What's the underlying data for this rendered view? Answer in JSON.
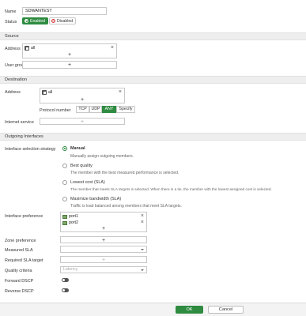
{
  "form": {
    "name_label": "Name",
    "name_value": "SDWANTEST",
    "status_label": "Status",
    "status_enabled": "Enabled",
    "status_disabled": "Disabled",
    "status_selected": "Enabled"
  },
  "source": {
    "header": "Source",
    "address_label": "Address",
    "address_items": [
      "all"
    ],
    "user_group_label": "User group"
  },
  "destination": {
    "header": "Destination",
    "address_label": "Address",
    "address_items": [
      "all"
    ],
    "protocol_label": "Protocol number",
    "protocol_options": [
      "TCP",
      "UDP",
      "ANY",
      "Specify"
    ],
    "protocol_selected": "ANY",
    "internet_service_label": "Internet service"
  },
  "outgoing": {
    "header": "Outgoing Interfaces",
    "strategy_label": "Interface selection strategy",
    "strategies": [
      {
        "title": "Manual",
        "desc": "Manually assign outgoing members."
      },
      {
        "title": "Best quality",
        "desc": "The member with the best measured performance is selected."
      },
      {
        "title": "Lowest cost (SLA)",
        "desc": "The member that meets SLA targets is selected. When there is a tie, the member with the lowest assigned cost is selected."
      },
      {
        "title": "Maximize bandwidth (SLA)",
        "desc": "Traffic is load balanced among members that meet SLA targets."
      }
    ],
    "strategy_selected": "Manual",
    "interface_pref_label": "Interface preference",
    "interface_pref_items": [
      "port1",
      "port2"
    ],
    "zone_pref_label": "Zone preference",
    "measured_sla_label": "Measured SLA",
    "required_sla_label": "Required SLA target",
    "quality_criteria_label": "Quality criteria",
    "quality_criteria_value": "Latency",
    "forward_dscp_label": "Forward DSCP",
    "reverse_dscp_label": "Reverse DSCP",
    "forward_dscp_on": false,
    "reverse_dscp_on": false
  },
  "footer": {
    "ok_label": "OK",
    "cancel_label": "Cancel"
  },
  "icons": {
    "add": "+",
    "remove": "×"
  },
  "colors": {
    "accent": "#2e8b40",
    "disabled_red": "#d63b3b",
    "section_bg": "#eeeeee"
  }
}
